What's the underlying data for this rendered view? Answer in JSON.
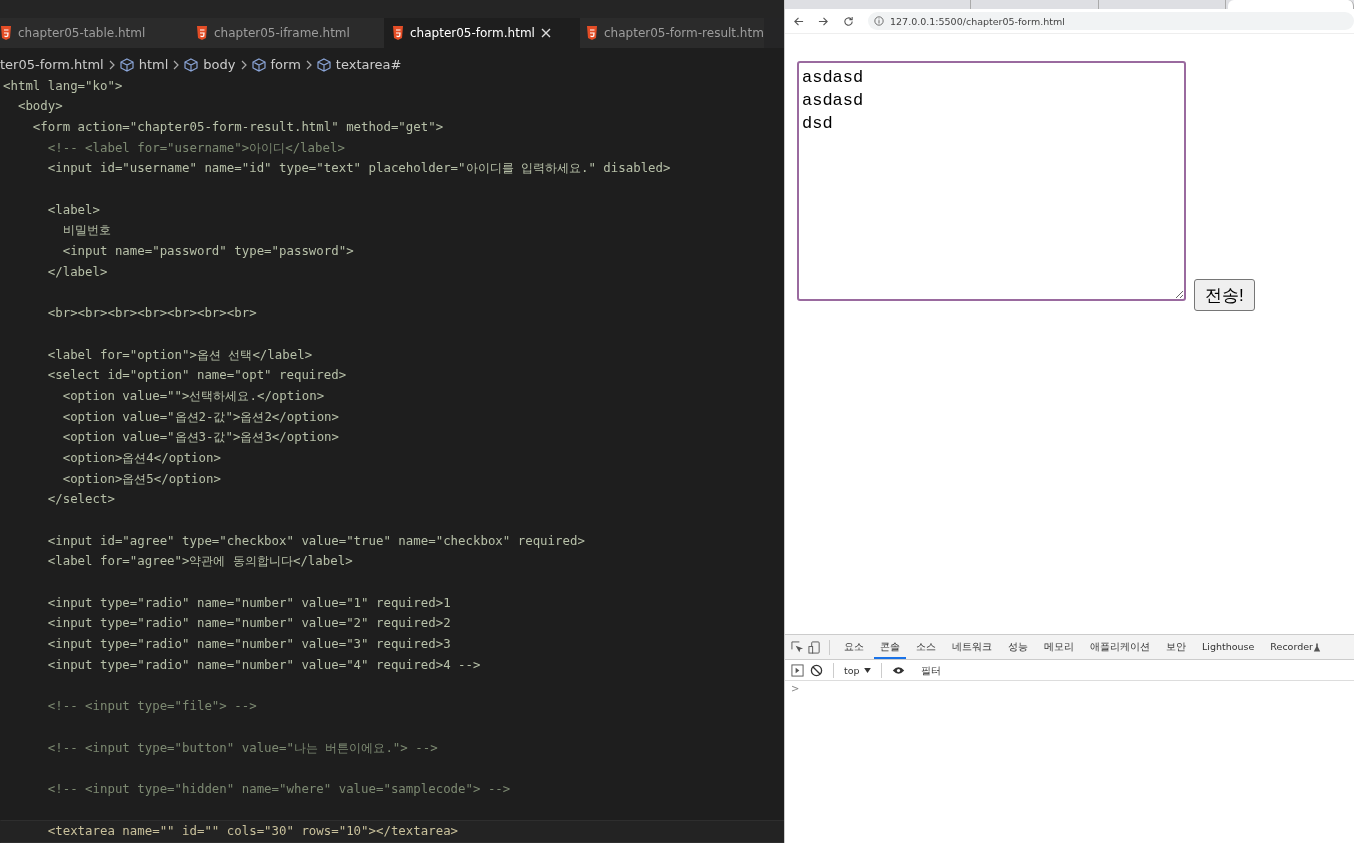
{
  "editor": {
    "tabs": [
      {
        "label": "chapter05-table.html",
        "selected": false
      },
      {
        "label": "chapter05-iframe.html",
        "selected": false
      },
      {
        "label": "chapter05-form.html",
        "selected": true
      },
      {
        "label": "chapter05-form-result.htm",
        "selected": false
      }
    ],
    "breadcrumb": [
      "ter05-form.html",
      "html",
      "body",
      "form",
      "textarea#"
    ],
    "lines": [
      {
        "kind": "code",
        "text": "<html lang=\"ko\">"
      },
      {
        "kind": "code",
        "text": "  <body>"
      },
      {
        "kind": "code",
        "text": "    <form action=\"chapter05-form-result.html\" method=\"get\">"
      },
      {
        "kind": "comment",
        "text": "      <!-- <label for=\"username\">아이디</label>"
      },
      {
        "kind": "code",
        "text": "      <input id=\"username\" name=\"id\" type=\"text\" placeholder=\"아이디를 입력하세요.\" disabled>"
      },
      {
        "kind": "blank"
      },
      {
        "kind": "code",
        "text": "      <label>"
      },
      {
        "kind": "code",
        "text": "        비밀번호"
      },
      {
        "kind": "code",
        "text": "        <input name=\"password\" type=\"password\">"
      },
      {
        "kind": "code",
        "text": "      </label>"
      },
      {
        "kind": "blank"
      },
      {
        "kind": "code",
        "text": "      <br><br><br><br><br><br><br>"
      },
      {
        "kind": "blank"
      },
      {
        "kind": "code",
        "text": "      <label for=\"option\">옵션 선택</label>"
      },
      {
        "kind": "code",
        "text": "      <select id=\"option\" name=\"opt\" required>"
      },
      {
        "kind": "code",
        "text": "        <option value=\"\">선택하세요.</option>"
      },
      {
        "kind": "code",
        "text": "        <option value=\"옵션2-값\">옵션2</option>"
      },
      {
        "kind": "code",
        "text": "        <option value=\"옵션3-값\">옵션3</option>"
      },
      {
        "kind": "code",
        "text": "        <option>옵션4</option>"
      },
      {
        "kind": "code",
        "text": "        <option>옵션5</option>"
      },
      {
        "kind": "code",
        "text": "      </select>"
      },
      {
        "kind": "blank"
      },
      {
        "kind": "code",
        "text": "      <input id=\"agree\" type=\"checkbox\" value=\"true\" name=\"checkbox\" required>"
      },
      {
        "kind": "code",
        "text": "      <label for=\"agree\">약관에 동의합니다</label>"
      },
      {
        "kind": "blank"
      },
      {
        "kind": "code",
        "text": "      <input type=\"radio\" name=\"number\" value=\"1\" required>1"
      },
      {
        "kind": "code",
        "text": "      <input type=\"radio\" name=\"number\" value=\"2\" required>2"
      },
      {
        "kind": "code",
        "text": "      <input type=\"radio\" name=\"number\" value=\"3\" required>3"
      },
      {
        "kind": "code",
        "text": "      <input type=\"radio\" name=\"number\" value=\"4\" required>4 -->"
      },
      {
        "kind": "blank"
      },
      {
        "kind": "comment",
        "text": "      <!-- <input type=\"file\"> -->"
      },
      {
        "kind": "blank"
      },
      {
        "kind": "comment",
        "text": "      <!-- <input type=\"button\" value=\"나는 버튼이에요.\"> -->"
      },
      {
        "kind": "blank"
      },
      {
        "kind": "comment",
        "text": "      <!-- <input type=\"hidden\" name=\"where\" value=\"samplecode\"> -->"
      },
      {
        "kind": "blank"
      },
      {
        "kind": "current",
        "text": "      <textarea name=\"\" id=\"\" cols=\"30\" rows=\"10\"></textarea>"
      }
    ]
  },
  "browser": {
    "tabs": [
      {
        "selected": false
      },
      {
        "selected": false
      },
      {
        "selected": false
      },
      {
        "selected": true
      }
    ],
    "url": "127.0.0.1:5500/chapter05-form.html",
    "textarea": "asdasd\nasdasd\ndsd\n",
    "submit": "전송!",
    "devtools": {
      "tabs": [
        {
          "label": "요소",
          "selected": false
        },
        {
          "label": "콘솔",
          "selected": true
        },
        {
          "label": "소스",
          "selected": false
        },
        {
          "label": "네트워크",
          "selected": false
        },
        {
          "label": "성능",
          "selected": false
        },
        {
          "label": "메모리",
          "selected": false
        },
        {
          "label": "애플리케이션",
          "selected": false
        },
        {
          "label": "보안",
          "selected": false
        },
        {
          "label": "Lighthouse",
          "selected": false
        },
        {
          "label": "Recorder",
          "selected": false
        }
      ],
      "context": "top",
      "filter_placeholder": "필터",
      "prompt": ">"
    }
  }
}
